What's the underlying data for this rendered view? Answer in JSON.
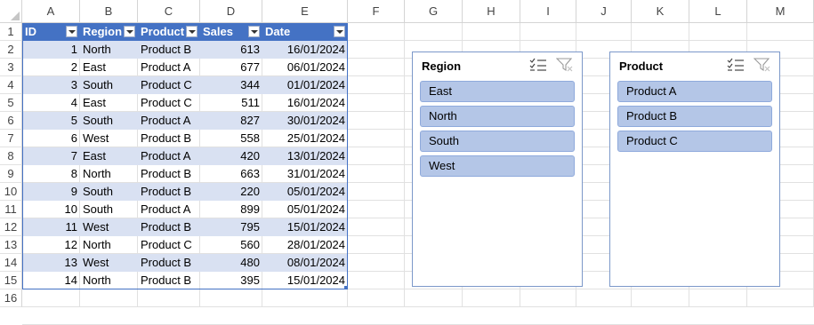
{
  "columns": [
    "A",
    "B",
    "C",
    "D",
    "E",
    "F",
    "G",
    "H",
    "I",
    "J",
    "K",
    "L",
    "M"
  ],
  "rows": [
    "1",
    "2",
    "3",
    "4",
    "5",
    "6",
    "7",
    "8",
    "9",
    "10",
    "11",
    "12",
    "13",
    "14",
    "15",
    "16"
  ],
  "table": {
    "headers": [
      "ID",
      "Region",
      "Product",
      "Sales",
      "Date"
    ],
    "data": [
      [
        "1",
        "North",
        "Product B",
        "613",
        "16/01/2024"
      ],
      [
        "2",
        "East",
        "Product A",
        "677",
        "06/01/2024"
      ],
      [
        "3",
        "South",
        "Product C",
        "344",
        "01/01/2024"
      ],
      [
        "4",
        "East",
        "Product C",
        "511",
        "16/01/2024"
      ],
      [
        "5",
        "South",
        "Product A",
        "827",
        "30/01/2024"
      ],
      [
        "6",
        "West",
        "Product B",
        "558",
        "25/01/2024"
      ],
      [
        "7",
        "East",
        "Product A",
        "420",
        "13/01/2024"
      ],
      [
        "8",
        "North",
        "Product B",
        "663",
        "31/01/2024"
      ],
      [
        "9",
        "South",
        "Product B",
        "220",
        "05/01/2024"
      ],
      [
        "10",
        "South",
        "Product A",
        "899",
        "05/01/2024"
      ],
      [
        "11",
        "West",
        "Product B",
        "795",
        "15/01/2024"
      ],
      [
        "12",
        "North",
        "Product C",
        "560",
        "28/01/2024"
      ],
      [
        "13",
        "West",
        "Product B",
        "480",
        "08/01/2024"
      ],
      [
        "14",
        "North",
        "Product B",
        "395",
        "15/01/2024"
      ]
    ]
  },
  "slicers": {
    "region": {
      "title": "Region",
      "items": [
        "East",
        "North",
        "South",
        "West"
      ]
    },
    "product": {
      "title": "Product",
      "items": [
        "Product A",
        "Product B",
        "Product C"
      ]
    }
  },
  "colors": {
    "header_blue": "#4472c4",
    "band": "#d9e1f2",
    "slicer_item": "#b4c6e7"
  }
}
